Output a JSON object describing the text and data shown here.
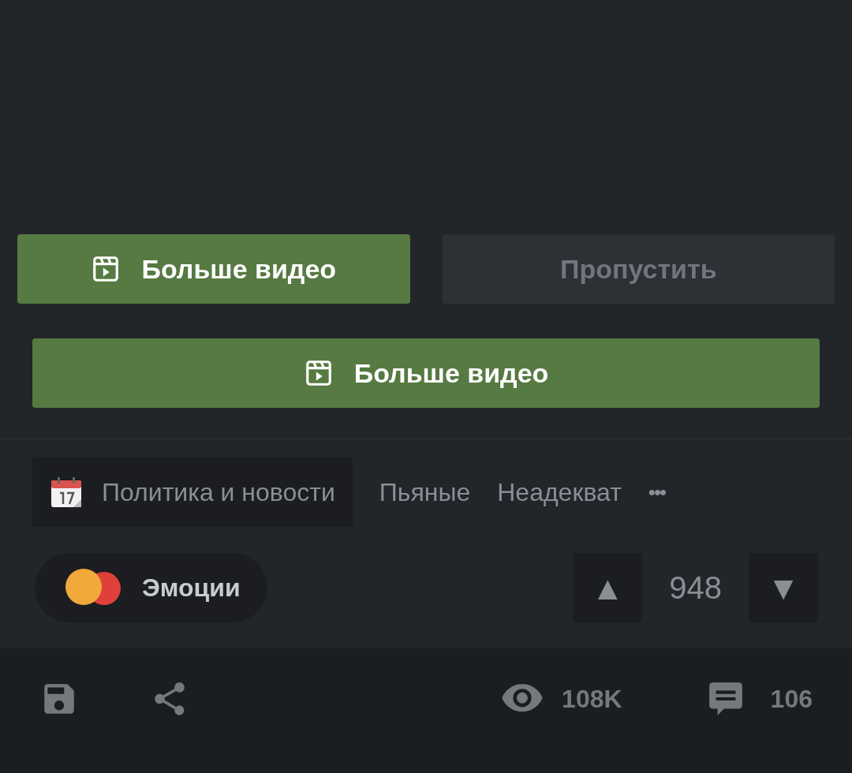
{
  "buttons_row": [
    {
      "label": "Больше видео",
      "kind": "primary"
    },
    {
      "label": "Пропустить",
      "kind": "secondary"
    }
  ],
  "wide_button": {
    "label": "Больше видео",
    "kind": "primary"
  },
  "tags": [
    {
      "label": "Политика и новости",
      "kind": "community"
    },
    {
      "label": "Пьяные",
      "kind": "tag"
    },
    {
      "label": "Неадекват",
      "kind": "tag"
    },
    {
      "label": "•••",
      "kind": "more"
    }
  ],
  "emotion_chip": {
    "label": "Эмоции"
  },
  "rating": {
    "up": "▲",
    "score": "948",
    "down": "▼"
  },
  "footer": {
    "views": "108K",
    "comments": "106"
  }
}
